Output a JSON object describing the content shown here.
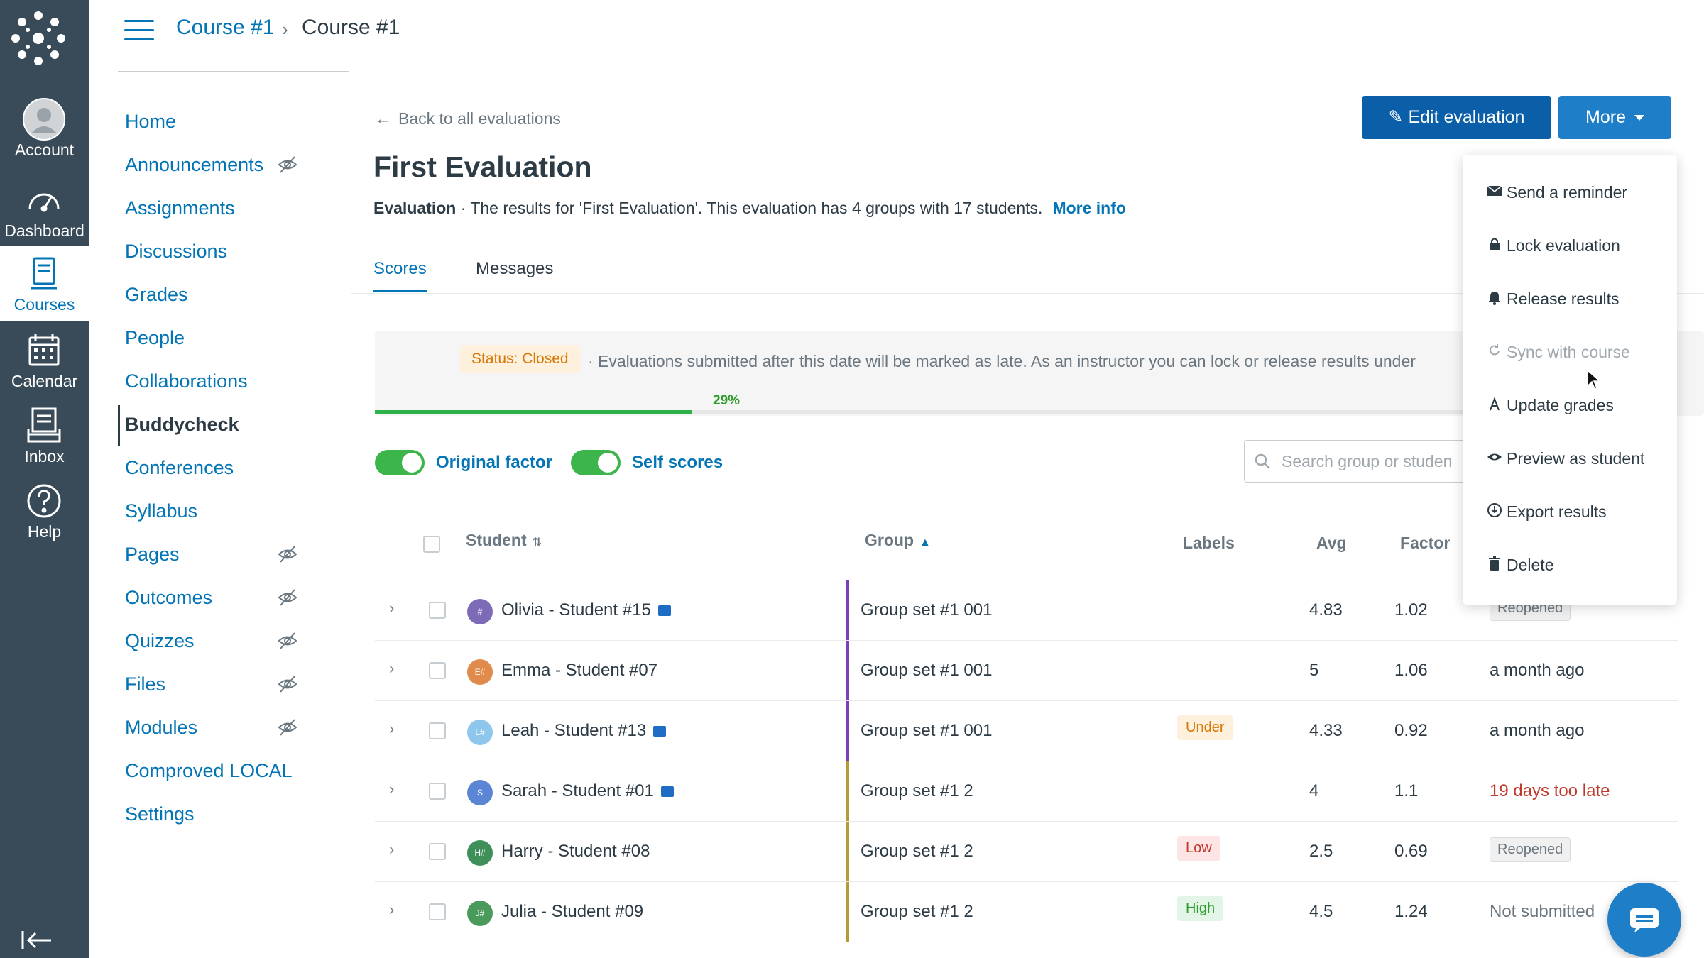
{
  "global_nav": {
    "items": [
      {
        "label": "Account",
        "icon": "account-icon"
      },
      {
        "label": "Dashboard",
        "icon": "dashboard-icon"
      },
      {
        "label": "Courses",
        "icon": "courses-icon",
        "active": true
      },
      {
        "label": "Calendar",
        "icon": "calendar-icon"
      },
      {
        "label": "Inbox",
        "icon": "inbox-icon"
      },
      {
        "label": "Help",
        "icon": "help-icon"
      }
    ],
    "colors": {
      "background": "#394b58",
      "accent": "#0374b5"
    }
  },
  "header": {
    "breadcrumb": [
      "Course #1",
      "Course #1"
    ],
    "separator": "›"
  },
  "course_nav": {
    "items": [
      {
        "label": "Home",
        "hidden": false
      },
      {
        "label": "Announcements",
        "hidden": true
      },
      {
        "label": "Assignments",
        "hidden": false
      },
      {
        "label": "Discussions",
        "hidden": false
      },
      {
        "label": "Grades",
        "hidden": false
      },
      {
        "label": "People",
        "hidden": false
      },
      {
        "label": "Collaborations",
        "hidden": false
      },
      {
        "label": "Buddycheck",
        "hidden": false,
        "active": true
      },
      {
        "label": "Conferences",
        "hidden": false
      },
      {
        "label": "Syllabus",
        "hidden": false
      },
      {
        "label": "Pages",
        "hidden": true
      },
      {
        "label": "Outcomes",
        "hidden": true
      },
      {
        "label": "Quizzes",
        "hidden": true
      },
      {
        "label": "Files",
        "hidden": true
      },
      {
        "label": "Modules",
        "hidden": true
      },
      {
        "label": "Comproved LOCAL",
        "hidden": false
      },
      {
        "label": "Settings",
        "hidden": false
      }
    ]
  },
  "main": {
    "back_link": "Back to all evaluations",
    "title": "First Evaluation",
    "description": {
      "type": "Evaluation",
      "text": " · The results for 'First Evaluation'. This evaluation has 4 groups with 17 students.",
      "more_link": "More info"
    },
    "buttons": {
      "edit": "Edit evaluation",
      "more": "More"
    },
    "tabs": [
      "Scores",
      "Messages"
    ],
    "status": {
      "pill": "Status: Closed",
      "text": "· Evaluations submitted after this date will be marked as late. As an instructor you can lock or release results under",
      "progress_label": "29%",
      "progress": 0.29
    },
    "toggles": [
      {
        "label": "Original factor",
        "on": true
      },
      {
        "label": "Self scores",
        "on": true
      }
    ],
    "search_placeholder": "Search group or studen",
    "table": {
      "headers": {
        "student": "Student",
        "group": "Group",
        "labels": "Labels",
        "avg": "Avg",
        "factor": "Factor"
      },
      "rows": [
        {
          "initials": "#",
          "avatar_color": "#7e6bb8",
          "name": "Olivia - Student #15",
          "message": true,
          "group": "Group set #1 001",
          "group_color": "#7b3fb8",
          "label": "",
          "avg": "4.83",
          "factor": "1.02",
          "status": "Reopened",
          "status_kind": "pill"
        },
        {
          "initials": "E#",
          "avatar_color": "#e08a4c",
          "name": "Emma - Student #07",
          "message": false,
          "group": "Group set #1 001",
          "group_color": "#7b3fb8",
          "label": "",
          "avg": "5",
          "factor": "1.06",
          "status": "a month ago",
          "status_kind": "normal"
        },
        {
          "initials": "L#",
          "avatar_color": "#8ec6ec",
          "name": "Leah - Student #13",
          "message": true,
          "group": "Group set #1 001",
          "group_color": "#7b3fb8",
          "label": "Under",
          "label_kind": "under",
          "avg": "4.33",
          "factor": "0.92",
          "status": "a month ago",
          "status_kind": "normal"
        },
        {
          "initials": "S",
          "avatar_color": "#5b86d6",
          "name": "Sarah - Student #01",
          "message": true,
          "group": "Group set #1 2",
          "group_color": "#b59a3a",
          "label": "",
          "avg": "4",
          "factor": "1.1",
          "status": "19 days too late",
          "status_kind": "late"
        },
        {
          "initials": "H#",
          "avatar_color": "#3f8f5a",
          "name": "Harry - Student #08",
          "message": false,
          "group": "Group set #1 2",
          "group_color": "#b59a3a",
          "label": "Low",
          "label_kind": "low",
          "avg": "2.5",
          "factor": "0.69",
          "status": "Reopened",
          "status_kind": "pill"
        },
        {
          "initials": "J#",
          "avatar_color": "#4a9a5c",
          "name": "Julia - Student #09",
          "message": false,
          "group": "Group set #1 2",
          "group_color": "#b59a3a",
          "label": "High",
          "label_kind": "high",
          "avg": "4.5",
          "factor": "1.24",
          "status": "Not submitted",
          "status_kind": "muted"
        }
      ]
    }
  },
  "more_menu": {
    "items": [
      {
        "label": "Send a reminder",
        "icon": "envelope-icon",
        "disabled": false
      },
      {
        "label": "Lock evaluation",
        "icon": "lock-icon",
        "disabled": false
      },
      {
        "label": "Release results",
        "icon": "bell-icon",
        "disabled": false
      },
      {
        "label": "Sync with course",
        "icon": "sync-icon",
        "disabled": true
      },
      {
        "label": "Update grades",
        "icon": "grades-icon",
        "disabled": false
      },
      {
        "label": "Preview as student",
        "icon": "eye-icon",
        "disabled": false
      },
      {
        "label": "Export results",
        "icon": "export-icon",
        "disabled": false
      },
      {
        "label": "Delete",
        "icon": "trash-icon",
        "disabled": false
      }
    ]
  }
}
